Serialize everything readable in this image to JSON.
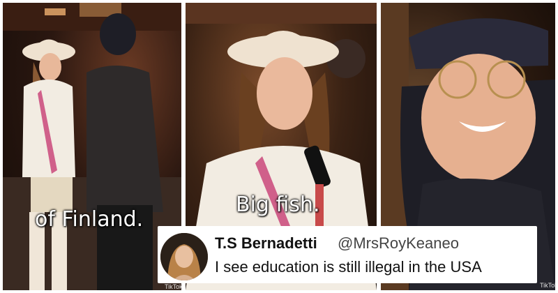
{
  "panels": [
    {
      "caption": "of Finland.",
      "watermark": "TikTok"
    },
    {
      "caption": "Big fish."
    },
    {
      "watermark": "TikTok"
    }
  ],
  "tweet": {
    "display_name": "T.S Bernadetti",
    "handle": "@MrsRoyKeaneo",
    "text": "I see education is still illegal in the USA"
  },
  "colors": {
    "background": "#ffffff",
    "caption_text": "#ffffff",
    "hat": "#efe2d0"
  }
}
